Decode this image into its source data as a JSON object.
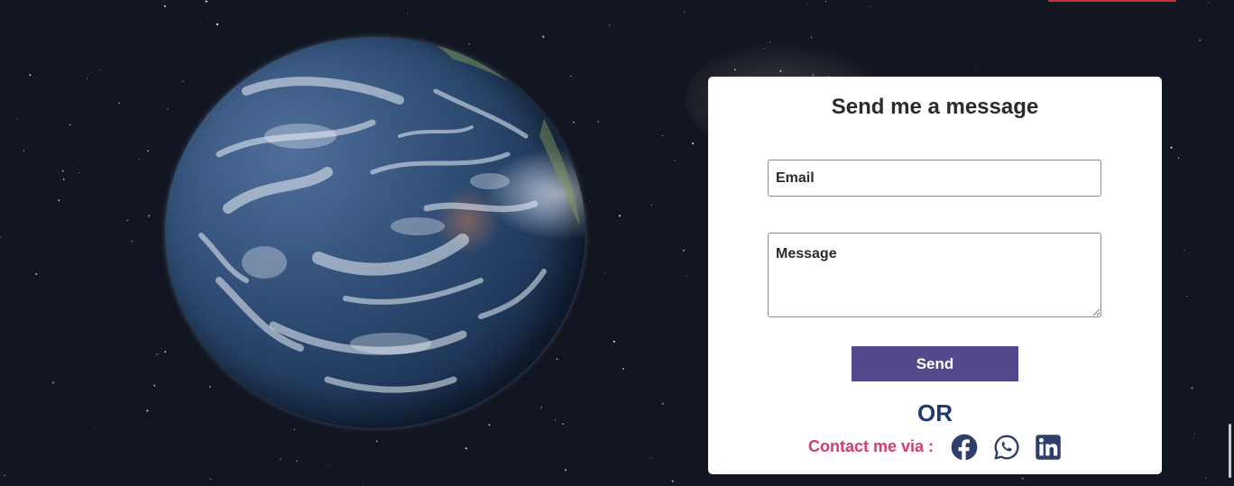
{
  "contact_form": {
    "title": "Send me a message",
    "email_placeholder": "Email",
    "message_placeholder": "Message",
    "send_label": "Send",
    "or_text": "OR",
    "contact_via_label": "Contact me via :"
  },
  "social": {
    "items": [
      "facebook-icon",
      "whatsapp-icon",
      "linkedin-icon"
    ]
  },
  "colors": {
    "background": "#121621",
    "send_button": "#524a8a",
    "or_text": "#1e3a73",
    "contact_label": "#d83a6a",
    "social_icons": "#2f3f6b",
    "top_accent": "#c0343a"
  }
}
